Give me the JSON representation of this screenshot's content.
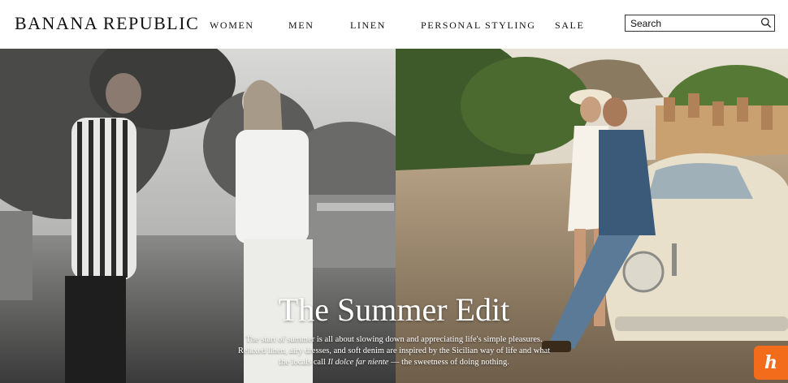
{
  "header": {
    "logo": "BANANA REPUBLIC",
    "nav": [
      "WOMEN",
      "MEN",
      "LINEN",
      "PERSONAL STYLING",
      "SALE"
    ],
    "search_placeholder": "Search",
    "search_icon": "search-icon"
  },
  "hero": {
    "title": "The Summer Edit",
    "copy_line1": "The start of summer is all about slowing down and appreciating life's simple pleasures.",
    "copy_line2": "Relaxed linen, airy dresses, and soft denim are inspired by the Sicilian way of life and what",
    "copy_line3_pre": "the locals call",
    "copy_line3_em": "Il dolce far niente",
    "copy_line3_post": "— the sweetness of doing nothing.",
    "left_image": "black-and-white photo of couple on terrace",
    "right_image": "color photo of couple leaning on vintage car"
  },
  "widget": {
    "label": "h",
    "color": "#f26c1b"
  }
}
